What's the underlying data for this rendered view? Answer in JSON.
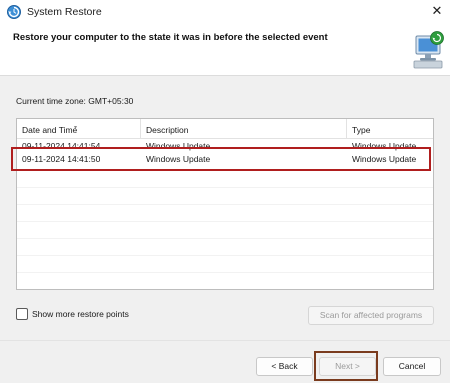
{
  "window": {
    "title": "System Restore",
    "close_glyph": "✕",
    "app_icon": "system-restore-icon"
  },
  "header": {
    "text": "Restore your computer to the state it was in before the selected event",
    "art_icon": "monitor-restore-icon"
  },
  "timezone": {
    "text": "Current time zone: GMT+05:30"
  },
  "restore_list": {
    "columns": [
      "Date and Time",
      "Description",
      "Type"
    ],
    "sort_glyph": "▾",
    "rows": [
      {
        "date": "09-11-2024 14:41:54",
        "description": "Windows Update",
        "type": "Windows Update"
      },
      {
        "date": "09-11-2024 14:41:50",
        "description": "Windows Update",
        "type": "Windows Update"
      }
    ],
    "highlight_color": "#b01e1e"
  },
  "options": {
    "show_more_label": "Show more restore points",
    "show_more_checked": false,
    "scan_label": "Scan for affected programs"
  },
  "footer": {
    "back_label": "< Back",
    "next_label": "Next >",
    "cancel_label": "Cancel",
    "next_highlight_color": "#7a3b1e"
  }
}
